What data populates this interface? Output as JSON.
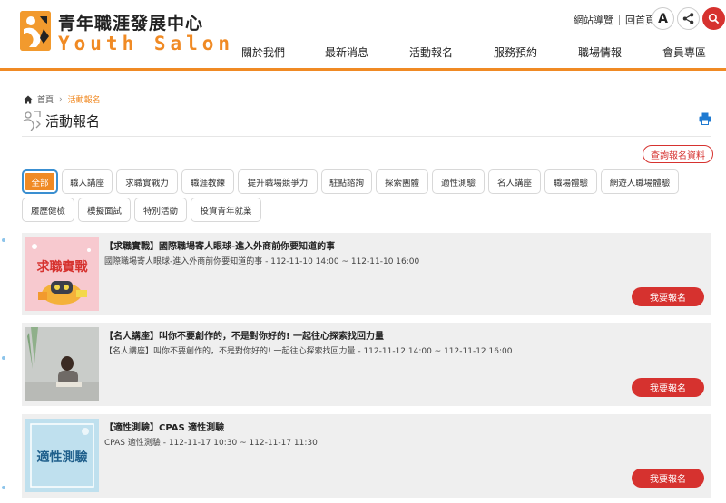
{
  "brand": {
    "name_cn": "青年職涯發展中心",
    "name_en": "Youth Salon"
  },
  "top_links": {
    "sitemap": "網站導覽",
    "home": "回首頁",
    "font_button": "A"
  },
  "nav": {
    "items": [
      "關於我們",
      "最新消息",
      "活動報名",
      "服務預約",
      "職場情報",
      "會員專區"
    ]
  },
  "breadcrumb": {
    "home": "首頁",
    "separator": "›",
    "current": "活動報名"
  },
  "page": {
    "title": "活動報名",
    "query_button": "查詢報名資料"
  },
  "filters": {
    "active": "全部",
    "items": [
      "全部",
      "職人講座",
      "求職實戰力",
      "職涯教練",
      "提升職場競爭力",
      "駐點諮詢",
      "探索團體",
      "適性測驗",
      "名人講座",
      "職場體驗",
      "網遊人職場體驗",
      "履歷健檢",
      "模擬面試",
      "特別活動",
      "投資青年就業"
    ]
  },
  "events": [
    {
      "title": "【求職實戰】國際職場寄人眼球-進入外商前你要知道的事",
      "desc": "國際職場寄人眼球-進入外商前你要知道的事 - 112-11-10 14:00 ~ 112-11-10 16:00",
      "image_text": "求職實戰",
      "button": "我要報名"
    },
    {
      "title": "【名人講座】叫你不要創作的，不是對你好的! 一起往心探索找回力量",
      "desc": "【名人講座】叫你不要創作的，不是對你好的! 一起往心探索找回力量 - 112-11-12 14:00 ~ 112-11-12 16:00",
      "image_text": "",
      "button": "我要報名"
    },
    {
      "title": "【適性測驗】CPAS 適性測驗",
      "desc": "CPAS 適性測驗 - 112-11-17 10:30 ~ 112-11-17 11:30",
      "image_text": "適性測驗",
      "button": "我要報名"
    }
  ],
  "colors": {
    "accent": "#f08a24",
    "danger": "#d6322f",
    "card_bg": "#efefef",
    "focus": "#3a8fd1"
  },
  "icons": {
    "share": "share-icon",
    "search": "search-icon",
    "home": "home-icon",
    "print": "print-icon"
  }
}
